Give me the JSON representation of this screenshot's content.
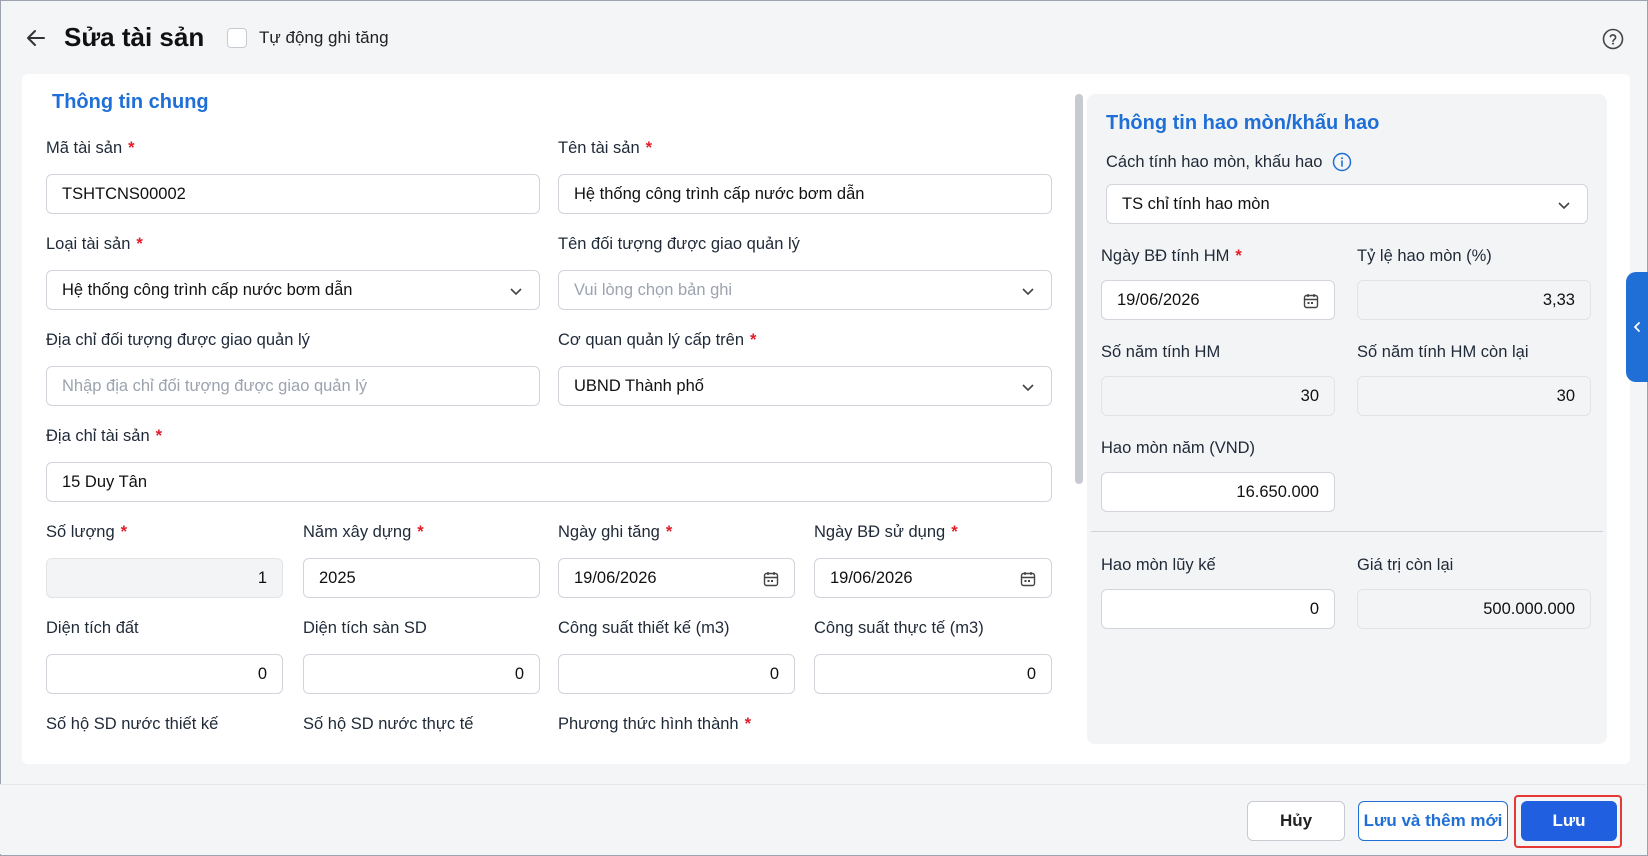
{
  "header": {
    "title": "Sửa tài sản",
    "auto_increase_label": "Tự động ghi tăng"
  },
  "general": {
    "section_title": "Thông tin chung",
    "asset_code": {
      "label": "Mã tài sản",
      "value": "TSHTCNS00002"
    },
    "asset_name": {
      "label": "Tên tài sản",
      "value": "Hệ thống công trình cấp nước bơm dẫn"
    },
    "asset_type": {
      "label": "Loại tài sản",
      "value": "Hệ thống công trình cấp nước bơm dẫn"
    },
    "assignee": {
      "label": "Tên đối tượng được giao quản lý",
      "placeholder": "Vui lòng chọn bản ghi"
    },
    "assignee_address": {
      "label": "Địa chỉ đối tượng được giao quản lý",
      "placeholder": "Nhập địa chỉ đối tượng được giao quản lý"
    },
    "parent_agency": {
      "label": "Cơ quan quản lý cấp trên",
      "value": "UBND Thành phố"
    },
    "asset_address": {
      "label": "Địa chỉ tài sản",
      "value": "15 Duy Tân"
    },
    "quantity": {
      "label": "Số lượng",
      "value": "1"
    },
    "build_year": {
      "label": "Năm xây dựng",
      "value": "2025"
    },
    "increase_date": {
      "label": "Ngày ghi tăng",
      "value": "19/06/2026"
    },
    "usage_start_date": {
      "label": "Ngày BĐ sử dụng",
      "value": "19/06/2026"
    },
    "land_area": {
      "label": "Diện tích đất",
      "value": "0"
    },
    "floor_area": {
      "label": "Diện tích sàn SD",
      "value": "0"
    },
    "design_capacity": {
      "label": "Công suất thiết kế (m3)",
      "value": "0"
    },
    "actual_capacity": {
      "label": "Công suất thực tế (m3)",
      "value": "0"
    },
    "design_households": {
      "label": "Số hộ SD nước thiết kế"
    },
    "actual_households": {
      "label": "Số hộ SD nước thực tế"
    },
    "formation_method": {
      "label": "Phương thức hình thành"
    }
  },
  "depreciation": {
    "section_title": "Thông tin hao mòn/khấu hao",
    "method": {
      "label": "Cách tính hao mòn, khấu hao",
      "value": "TS chỉ tính hao mòn"
    },
    "start_date": {
      "label": "Ngày BĐ tính HM",
      "value": "19/06/2026"
    },
    "rate": {
      "label": "Tỷ lệ hao mòn (%)",
      "value": "3,33"
    },
    "years": {
      "label": "Số năm tính HM",
      "value": "30"
    },
    "years_remaining": {
      "label": "Số năm tính HM còn lại",
      "value": "30"
    },
    "annual": {
      "label": "Hao mòn năm (VND)",
      "value": "16.650.000"
    },
    "accumulated": {
      "label": "Hao mòn lũy kế",
      "value": "0"
    },
    "remaining_value": {
      "label": "Giá trị còn lại",
      "value": "500.000.000"
    }
  },
  "footer": {
    "cancel": "Hủy",
    "save_and_new": "Lưu và thêm mới",
    "save": "Lưu"
  },
  "required_mark": "*",
  "colors": {
    "accent": "#1f6fd6",
    "primary_button": "#1f5fe0",
    "required": "#e11d2a",
    "highlight": "#e53935"
  }
}
